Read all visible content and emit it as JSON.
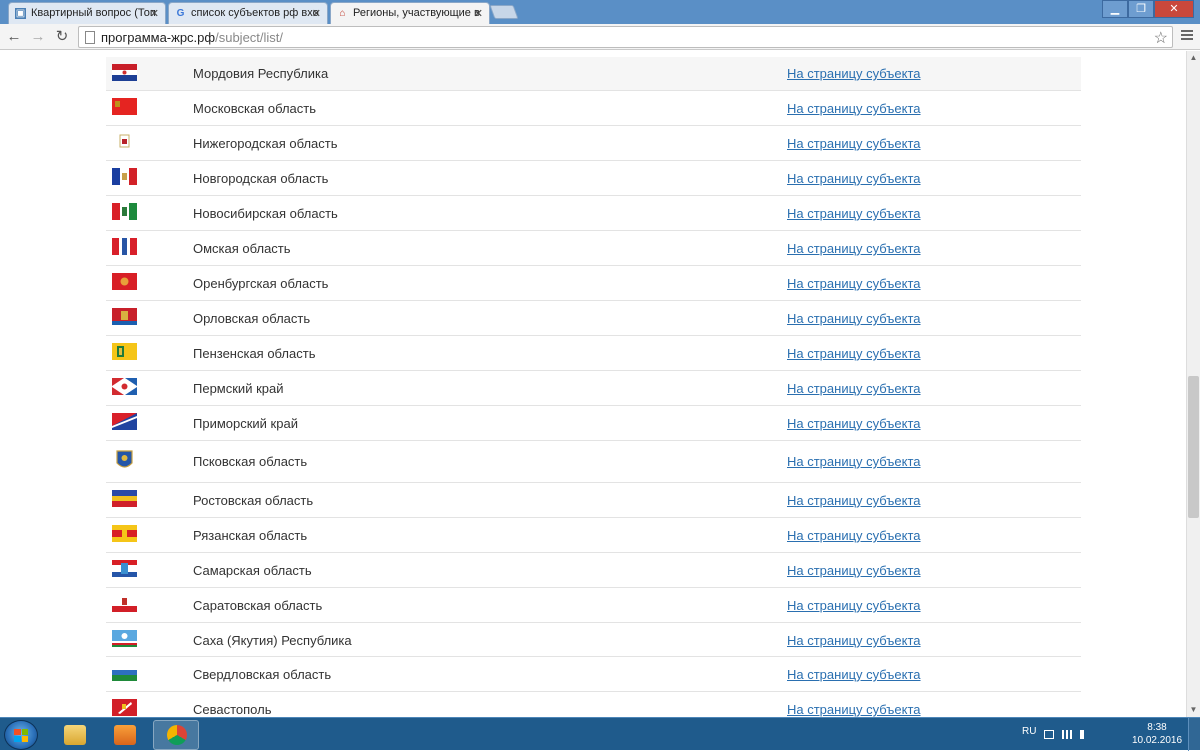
{
  "browser": {
    "tabs": [
      {
        "title": "Квартирный вопрос (Топ",
        "icon": "page-icon",
        "active": false
      },
      {
        "title": "список субъектов рф вхо",
        "icon": "google-icon",
        "active": false
      },
      {
        "title": "Регионы, участвующие в",
        "icon": "site-house-icon",
        "active": true
      }
    ],
    "url_host": "программа-жрс.рф",
    "url_path": "/subject/list/",
    "window_buttons": [
      "minimize",
      "restore",
      "close"
    ]
  },
  "subjects": {
    "link_label": "На страницу субъекта",
    "rows": [
      {
        "name": "Мордовия Республика",
        "flag": "mordovia-flag"
      },
      {
        "name": "Московская область",
        "flag": "moscow-oblast-flag"
      },
      {
        "name": "Нижегородская область",
        "flag": "nizhny-novgorod-flag"
      },
      {
        "name": "Новгородская область",
        "flag": "novgorod-flag"
      },
      {
        "name": "Новосибирская область",
        "flag": "novosibirsk-flag"
      },
      {
        "name": "Омская область",
        "flag": "omsk-flag"
      },
      {
        "name": "Оренбургская область",
        "flag": "orenburg-flag"
      },
      {
        "name": "Орловская область",
        "flag": "oryol-flag"
      },
      {
        "name": "Пензенская область",
        "flag": "penza-flag"
      },
      {
        "name": "Пермский край",
        "flag": "perm-flag"
      },
      {
        "name": "Приморский край",
        "flag": "primorsky-flag"
      },
      {
        "name": "Псковская область",
        "flag": "pskov-coat-of-arms"
      },
      {
        "name": "Ростовская область",
        "flag": "rostov-flag"
      },
      {
        "name": "Рязанская область",
        "flag": "ryazan-flag"
      },
      {
        "name": "Самарская область",
        "flag": "samara-flag"
      },
      {
        "name": "Саратовская область",
        "flag": "saratov-flag"
      },
      {
        "name": "Саха (Якутия) Республика",
        "flag": "yakutia-flag"
      },
      {
        "name": "Свердловская область",
        "flag": "sverdlovsk-flag"
      },
      {
        "name": "Севастополь",
        "flag": "sevastopol-flag"
      }
    ]
  },
  "taskbar": {
    "apps": [
      "file-explorer",
      "media-player",
      "chrome"
    ],
    "language": "RU",
    "time": "8:38",
    "date": "10.02.2016"
  }
}
